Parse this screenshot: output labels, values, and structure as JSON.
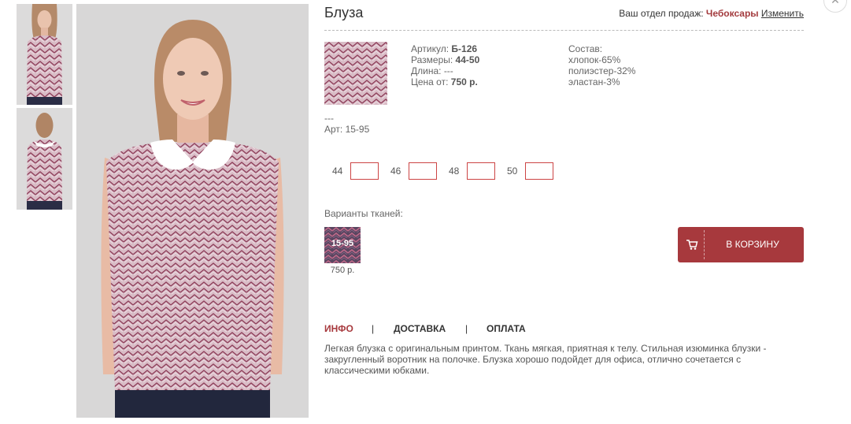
{
  "product": {
    "title": "Блуза",
    "sku_label": "Артикул: ",
    "sku": "Б-126",
    "sizes_label": "Размеры: ",
    "sizes_range": "44-50",
    "length_label": "Длина: ",
    "length": "---",
    "price_label": "Цена от: ",
    "price": "750 р.",
    "composition_title": "Состав:",
    "composition": [
      "хлопок-65%",
      "полиэстер-32%",
      "эластан-3%"
    ],
    "dash_line": "---",
    "fabric_art": "Арт: 15-95"
  },
  "dept": {
    "label": "Ваш отдел продаж: ",
    "city": "Чебоксары",
    "change": "Изменить"
  },
  "sizes": [
    {
      "label": "44",
      "value": ""
    },
    {
      "label": "46",
      "value": ""
    },
    {
      "label": "48",
      "value": ""
    },
    {
      "label": "50",
      "value": ""
    }
  ],
  "variants": {
    "label": "Варианты тканей:",
    "items": [
      {
        "code": "15-95",
        "price": "750 р."
      }
    ]
  },
  "cart": {
    "label": "В КОРЗИНУ"
  },
  "tabs": [
    {
      "label": "ИНФО",
      "active": true
    },
    {
      "label": "ДОСТАВКА",
      "active": false
    },
    {
      "label": "ОПЛАТА",
      "active": false
    }
  ],
  "tab_separator": "|",
  "description": "Легкая блузка с оригинальным принтом. Ткань мягкая, приятная к телу. Стильная изюминка блузки - закругленный воротник на полочке. Блузка хорошо подойдет для офиса, отлично сочетается с классическими юбками.",
  "colors": {
    "accent": "#a7393d",
    "fabric_base": "#d4b0bc",
    "fabric_stripe": "#8c3a55",
    "fabric_dark": "#41304f"
  },
  "icons": {
    "cart": "cart-icon",
    "close": "close-icon"
  }
}
